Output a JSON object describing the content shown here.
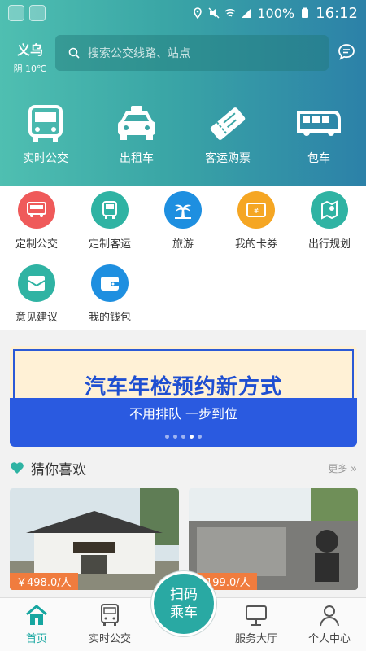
{
  "status": {
    "battery": "100%",
    "time": "16:12"
  },
  "location": {
    "city": "义乌",
    "weather": "阴 10℃"
  },
  "search": {
    "placeholder": "搜索公交线路、站点"
  },
  "top_nav": [
    {
      "label": "实时公交",
      "icon": "bus-icon"
    },
    {
      "label": "出租车",
      "icon": "taxi-icon"
    },
    {
      "label": "客运购票",
      "icon": "ticket-icon"
    },
    {
      "label": "包车",
      "icon": "coach-icon"
    }
  ],
  "services": [
    {
      "label": "定制公交",
      "icon": "custom-bus-icon",
      "color": "#ef5a5a"
    },
    {
      "label": "定制客运",
      "icon": "custom-coach-icon",
      "color": "#2fb3a3"
    },
    {
      "label": "旅游",
      "icon": "palm-tree-icon",
      "color": "#1e8fe0"
    },
    {
      "label": "我的卡券",
      "icon": "coupon-icon",
      "color": "#f5a623"
    },
    {
      "label": "出行规划",
      "icon": "route-plan-icon",
      "color": "#2fb3a3"
    },
    {
      "label": "意见建议",
      "icon": "feedback-icon",
      "color": "#2fb3a3"
    },
    {
      "label": "我的钱包",
      "icon": "wallet-icon",
      "color": "#1e8fe0"
    }
  ],
  "banner": {
    "title": "汽车年检预约新方式",
    "subtitle": "不用排队 一步到位",
    "active_slide": 3,
    "slide_count": 5
  },
  "recommend": {
    "title": "猜你喜欢",
    "more": "更多",
    "cards": [
      {
        "price": "￥498.0/人"
      },
      {
        "price": "￥199.0/人"
      }
    ]
  },
  "bottom_nav": [
    {
      "label": "首页",
      "icon": "home-icon"
    },
    {
      "label": "实时公交",
      "icon": "bus-icon"
    },
    {
      "label": "服务大厅",
      "icon": "monitor-icon"
    },
    {
      "label": "个人中心",
      "icon": "user-icon"
    }
  ],
  "scan_button": {
    "line1": "扫码",
    "line2": "乘车"
  },
  "colors": {
    "accent": "#16a6a0",
    "price_tag": "#f07c3e",
    "banner_blue": "#2a5ae0"
  }
}
